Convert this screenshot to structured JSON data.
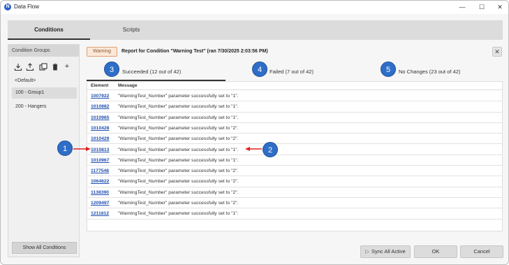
{
  "window": {
    "app_icon_glyph": "N",
    "title": "Data Flow",
    "controls": {
      "minimize": "—",
      "maximize": "☐",
      "close": "✕"
    }
  },
  "tabs": [
    {
      "label": "Conditions",
      "active": true
    },
    {
      "label": "Scripts",
      "active": false
    }
  ],
  "sidebar": {
    "header": "Condition Groups",
    "tools": [
      "import-icon",
      "export-icon",
      "duplicate-icon",
      "delete-icon",
      "add-icon"
    ],
    "add_glyph": "+",
    "items": [
      {
        "label": "<Default>",
        "selected": false
      },
      {
        "label": "100 - Group1",
        "selected": true
      },
      {
        "label": "200 - Hangers",
        "selected": false
      }
    ],
    "show_all_label": "Show All Conditions"
  },
  "report": {
    "badge": "Warning",
    "title": "Report for Condition \"Warning Test\" (ran 7/30/2025 2:03:56 PM)",
    "close_glyph": "✕",
    "status_tabs": [
      {
        "marker": "3",
        "label": "Succeeded (12 out of 42)",
        "active": true
      },
      {
        "marker": "4",
        "label": "Failed (7 out of 42)",
        "active": false
      },
      {
        "marker": "5",
        "label": "No Changes (23 out of 42)",
        "active": false
      }
    ],
    "columns": {
      "element": "Element",
      "message": "Message"
    },
    "rows": [
      {
        "element": "1007922",
        "message": "\"WarningTest_Number\" parameter successfully set to \"1\"."
      },
      {
        "element": "1010882",
        "message": "\"WarningTest_Number\" parameter successfully set to \"1\"."
      },
      {
        "element": "1010965",
        "message": "\"WarningTest_Number\" parameter successfully set to \"1\"."
      },
      {
        "element": "1010428",
        "message": "\"WarningTest_Number\" parameter successfully set to \"2\"."
      },
      {
        "element": "1010429",
        "message": "\"WarningTest_Number\" parameter successfully set to \"2\"."
      },
      {
        "element": "1010813",
        "message": "\"WarningTest_Number\" parameter successfully set to \"1\"."
      },
      {
        "element": "1010967",
        "message": "\"WarningTest_Number\" parameter successfully set to \"1\"."
      },
      {
        "element": "1177548",
        "message": "\"WarningTest_Number\" parameter successfully set to \"2\"."
      },
      {
        "element": "1064622",
        "message": "\"WarningTest_Number\" parameter successfully set to \"2\"."
      },
      {
        "element": "1138390",
        "message": "\"WarningTest_Number\" parameter successfully set to \"2\"."
      },
      {
        "element": "1209497",
        "message": "\"WarningTest_Number\" parameter successfully set to \"2\"."
      },
      {
        "element": "1211812",
        "message": "\"WarningTest_Number\" parameter successfully set to \"1\"."
      }
    ]
  },
  "callouts": [
    {
      "number": "1",
      "points_to": "element-id-link"
    },
    {
      "number": "2",
      "points_to": "message-text"
    }
  ],
  "buttons": {
    "sync_glyph": "▷",
    "sync_label": "Sync All Active",
    "ok_label": "OK",
    "cancel_label": "Cancel"
  },
  "colors": {
    "marker": "#2f6ec7",
    "arrow": "#e02020",
    "link": "#1f4fb0",
    "warning_bg": "#fbe8d8"
  }
}
